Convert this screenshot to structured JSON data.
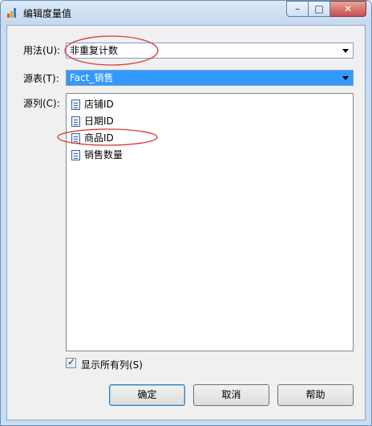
{
  "window": {
    "title": "编辑度量值"
  },
  "usage": {
    "label": "用法(U):",
    "value": "非重复计数"
  },
  "source_table": {
    "label": "源表(T):",
    "value": "Fact_销售"
  },
  "source_column": {
    "label": "源列(C):",
    "items": [
      {
        "label": "店铺ID"
      },
      {
        "label": "日期ID"
      },
      {
        "label": "商品ID"
      },
      {
        "label": "销售数量"
      }
    ]
  },
  "show_all_columns": {
    "label": "显示所有列(S)",
    "checked": true
  },
  "buttons": {
    "ok": "确定",
    "cancel": "取消",
    "help": "帮助"
  },
  "annotations": {
    "color": "#e03a3a"
  }
}
